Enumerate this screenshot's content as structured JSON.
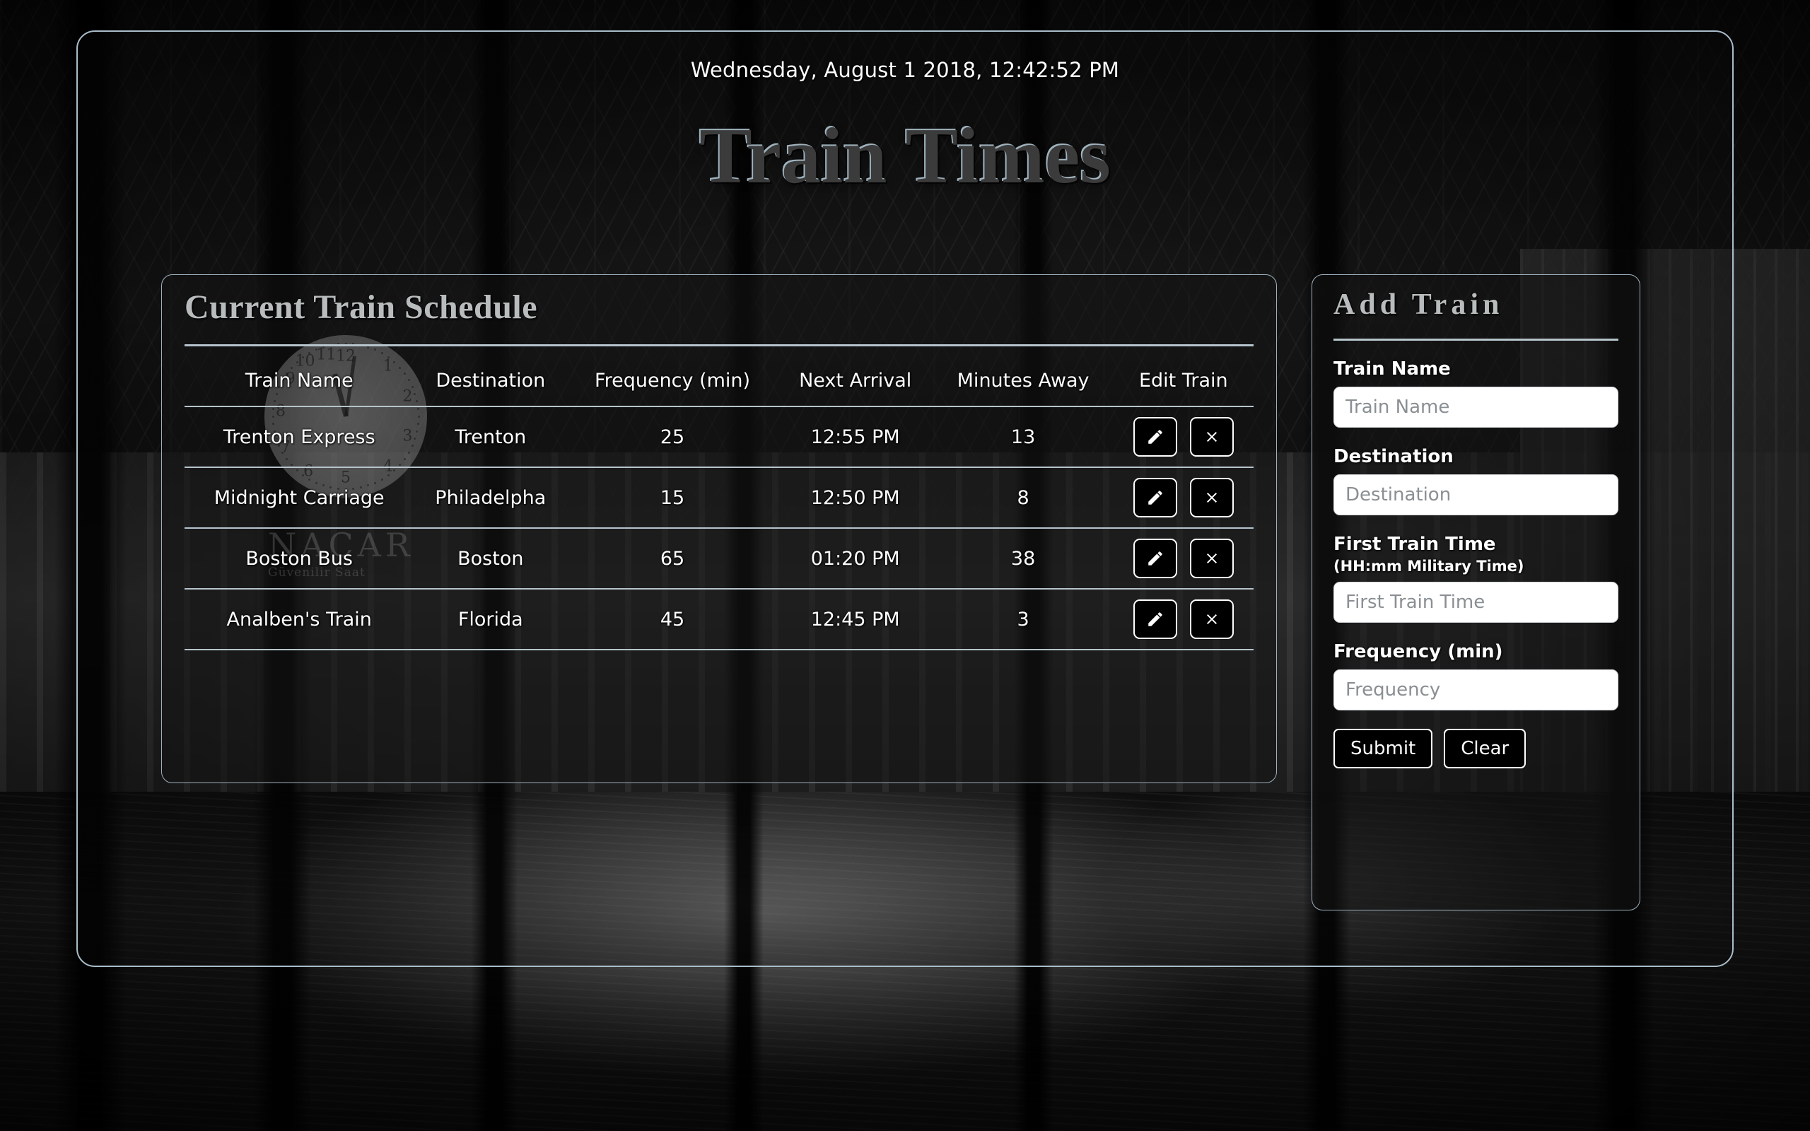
{
  "header": {
    "datetime": "Wednesday, August 1 2018, 12:42:52 PM",
    "title": "Train Times"
  },
  "schedule_panel": {
    "title": "Current Train Schedule",
    "watermark": {
      "brand": "NACAR",
      "tagline": "Güvenilir Saat"
    },
    "columns": [
      "Train Name",
      "Destination",
      "Frequency (min)",
      "Next Arrival",
      "Minutes Away",
      "Edit Train"
    ],
    "rows": [
      {
        "train_name": "Trenton Express",
        "destination": "Trenton",
        "frequency": "25",
        "next_arrival": "12:55 PM",
        "minutes_away": "13"
      },
      {
        "train_name": "Midnight Carriage",
        "destination": "Philadelpha",
        "frequency": "15",
        "next_arrival": "12:50 PM",
        "minutes_away": "8"
      },
      {
        "train_name": "Boston Bus",
        "destination": "Boston",
        "frequency": "65",
        "next_arrival": "01:20 PM",
        "minutes_away": "38"
      },
      {
        "train_name": "Analben's Train",
        "destination": "Florida",
        "frequency": "45",
        "next_arrival": "12:45 PM",
        "minutes_away": "3"
      }
    ],
    "row_actions": {
      "edit_icon": "pencil-icon",
      "delete_icon": "close-x-icon"
    }
  },
  "add_panel": {
    "title": "Add Train",
    "fields": [
      {
        "label": "Train Name",
        "sublabel": "",
        "placeholder": "Train Name",
        "value": ""
      },
      {
        "label": "Destination",
        "sublabel": "",
        "placeholder": "Destination",
        "value": ""
      },
      {
        "label": "First Train Time",
        "sublabel": "(HH:mm Military Time)",
        "placeholder": "First Train Time",
        "value": ""
      },
      {
        "label": "Frequency (min)",
        "sublabel": "",
        "placeholder": "Frequency",
        "value": ""
      }
    ],
    "submit_label": "Submit",
    "clear_label": "Clear"
  },
  "colors": {
    "frame_border": "#a9bdc9",
    "rule": "#b6c4cc",
    "title_fill": "#3b3b3b",
    "title_highlight": "#9fb2bd",
    "panel_title": "#b9bcbd",
    "text": "#ffffff",
    "button_bg": "#000000",
    "input_bg": "#ffffff",
    "placeholder": "#8a8f93"
  }
}
